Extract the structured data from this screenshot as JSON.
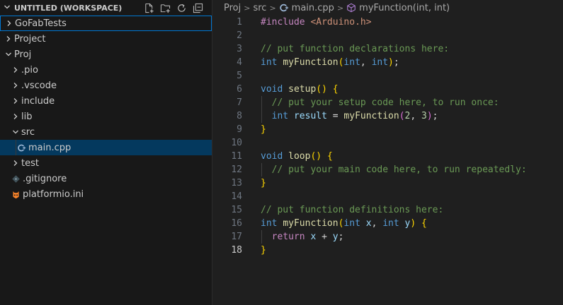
{
  "explorer": {
    "workspace_title": "UNTITLED (WORKSPACE)",
    "actions": [
      "new-file-icon",
      "new-folder-icon",
      "refresh-icon",
      "collapse-all-icon"
    ],
    "items": [
      {
        "label": "GoFabTests",
        "type": "folder",
        "depth": 0,
        "expanded": false,
        "state": "focused"
      },
      {
        "label": "Project",
        "type": "folder",
        "depth": 0,
        "expanded": false,
        "state": ""
      },
      {
        "label": "Proj",
        "type": "folder",
        "depth": 0,
        "expanded": true,
        "state": ""
      },
      {
        "label": ".pio",
        "type": "folder",
        "depth": 1,
        "expanded": false,
        "state": ""
      },
      {
        "label": ".vscode",
        "type": "folder",
        "depth": 1,
        "expanded": false,
        "state": ""
      },
      {
        "label": "include",
        "type": "folder",
        "depth": 1,
        "expanded": false,
        "state": ""
      },
      {
        "label": "lib",
        "type": "folder",
        "depth": 1,
        "expanded": false,
        "state": ""
      },
      {
        "label": "src",
        "type": "folder",
        "depth": 1,
        "expanded": true,
        "state": ""
      },
      {
        "label": "main.cpp",
        "type": "cpp",
        "depth": 2,
        "expanded": false,
        "state": "selected"
      },
      {
        "label": "test",
        "type": "folder",
        "depth": 1,
        "expanded": false,
        "state": ""
      },
      {
        "label": ".gitignore",
        "type": "gitignore",
        "depth": 1,
        "expanded": false,
        "state": ""
      },
      {
        "label": "platformio.ini",
        "type": "platformio",
        "depth": 1,
        "expanded": false,
        "state": ""
      }
    ]
  },
  "breadcrumbs": {
    "items": [
      "Proj",
      "src",
      "main.cpp",
      "myFunction(int, int)"
    ]
  },
  "editor": {
    "active_line": 18,
    "lines": [
      {
        "n": "1",
        "tokens": [
          [
            "pp",
            "#include "
          ],
          [
            "str",
            "<Arduino.h>"
          ]
        ]
      },
      {
        "n": "2",
        "tokens": []
      },
      {
        "n": "3",
        "tokens": [
          [
            "cm",
            "// put function declarations here:"
          ]
        ]
      },
      {
        "n": "4",
        "tokens": [
          [
            "kw",
            "int "
          ],
          [
            "fn",
            "myFunction"
          ],
          [
            "b1",
            "("
          ],
          [
            "kw",
            "int"
          ],
          [
            "pl",
            ", "
          ],
          [
            "kw",
            "int"
          ],
          [
            "b1",
            ")"
          ],
          [
            "pl",
            ";"
          ]
        ]
      },
      {
        "n": "5",
        "tokens": []
      },
      {
        "n": "6",
        "tokens": [
          [
            "kw",
            "void "
          ],
          [
            "fn",
            "setup"
          ],
          [
            "b1",
            "()"
          ],
          [
            "pl",
            " "
          ],
          [
            "b1",
            "{"
          ]
        ]
      },
      {
        "n": "7",
        "indent": true,
        "tokens": [
          [
            "pl",
            "  "
          ],
          [
            "cm",
            "// put your setup code here, to run once:"
          ]
        ]
      },
      {
        "n": "8",
        "indent": true,
        "tokens": [
          [
            "pl",
            "  "
          ],
          [
            "kw",
            "int "
          ],
          [
            "var",
            "result"
          ],
          [
            "pl",
            " = "
          ],
          [
            "fn",
            "myFunction"
          ],
          [
            "b2",
            "("
          ],
          [
            "num",
            "2"
          ],
          [
            "pl",
            ", "
          ],
          [
            "num",
            "3"
          ],
          [
            "b2",
            ")"
          ],
          [
            "pl",
            ";"
          ]
        ]
      },
      {
        "n": "9",
        "tokens": [
          [
            "b1",
            "}"
          ]
        ]
      },
      {
        "n": "10",
        "tokens": []
      },
      {
        "n": "11",
        "tokens": [
          [
            "kw",
            "void "
          ],
          [
            "fn",
            "loop"
          ],
          [
            "b1",
            "()"
          ],
          [
            "pl",
            " "
          ],
          [
            "b1",
            "{"
          ]
        ]
      },
      {
        "n": "12",
        "indent": true,
        "tokens": [
          [
            "pl",
            "  "
          ],
          [
            "cm",
            "// put your main code here, to run repeatedly:"
          ]
        ]
      },
      {
        "n": "13",
        "tokens": [
          [
            "b1",
            "}"
          ]
        ]
      },
      {
        "n": "14",
        "tokens": []
      },
      {
        "n": "15",
        "tokens": [
          [
            "cm",
            "// put function definitions here:"
          ]
        ]
      },
      {
        "n": "16",
        "tokens": [
          [
            "kw",
            "int "
          ],
          [
            "fn",
            "myFunction"
          ],
          [
            "b1",
            "("
          ],
          [
            "kw",
            "int "
          ],
          [
            "var",
            "x"
          ],
          [
            "pl",
            ", "
          ],
          [
            "kw",
            "int "
          ],
          [
            "var",
            "y"
          ],
          [
            "b1",
            ")"
          ],
          [
            "pl",
            " "
          ],
          [
            "b1",
            "{"
          ]
        ]
      },
      {
        "n": "17",
        "indent": true,
        "tokens": [
          [
            "pl",
            "  "
          ],
          [
            "pp",
            "return "
          ],
          [
            "var",
            "x"
          ],
          [
            "pl",
            " + "
          ],
          [
            "var",
            "y"
          ],
          [
            "pl",
            ";"
          ]
        ]
      },
      {
        "n": "18",
        "tokens": [
          [
            "b1",
            "}"
          ]
        ]
      }
    ]
  }
}
